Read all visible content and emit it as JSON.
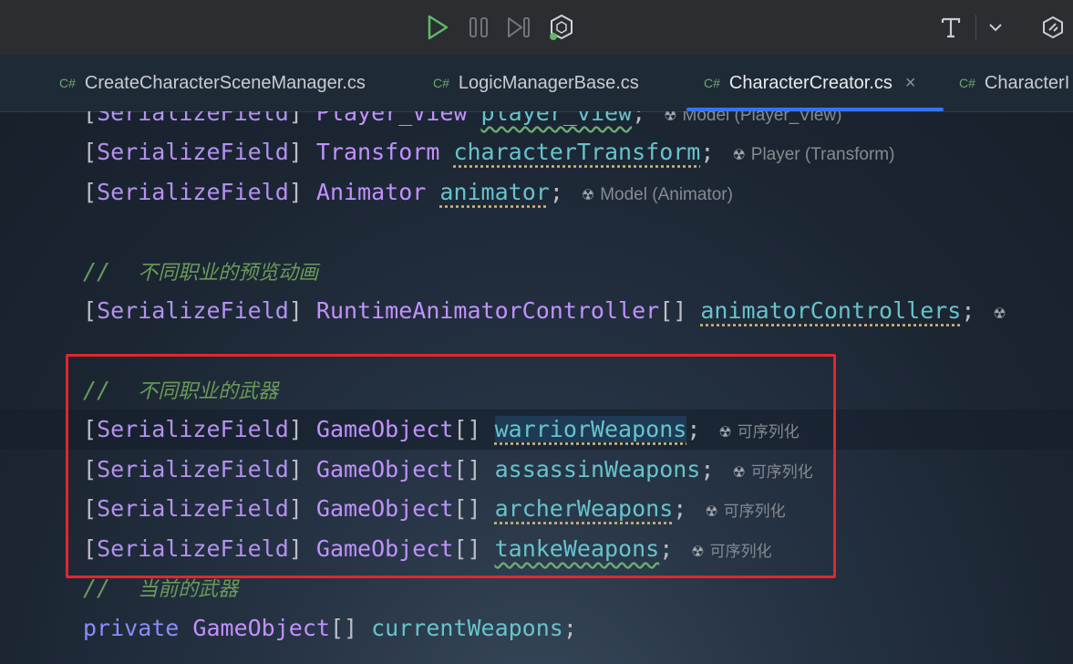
{
  "toolbar": {
    "run_icon": "play-icon",
    "pause_icon": "pause-icon",
    "step_icon": "step-icon",
    "unity_icon": "unity-debug-icon",
    "t_icon": "text-t-icon",
    "dropdown_icon": "chevron-down-icon",
    "settings_icon": "plugin-icon"
  },
  "tabs": [
    {
      "badge": "C#",
      "label": "CreateCharacterSceneManager.cs"
    },
    {
      "badge": "C#",
      "label": "LogicManagerBase.cs"
    },
    {
      "badge": "C#",
      "label": "CharacterCreator.cs",
      "close": "×"
    },
    {
      "badge": "C#",
      "label": "CharacterI"
    }
  ],
  "code": {
    "l0": {
      "open": "[",
      "attr": "SerializeField",
      "close": "]",
      "type": "Player_View",
      "field": "player_view",
      "semi": ";",
      "hint": "Model (Player_View)"
    },
    "l1": {
      "open": "[",
      "attr": "SerializeField",
      "close": "]",
      "type": "Transform",
      "field": "characterTransform",
      "semi": ";",
      "hint": "Player (Transform)"
    },
    "l2": {
      "open": "[",
      "attr": "SerializeField",
      "close": "]",
      "type": "Animator",
      "field": "animator",
      "semi": ";",
      "hint": "Model (Animator)"
    },
    "c1": {
      "slashes": "//",
      "text": "不同职业的预览动画"
    },
    "l3": {
      "open": "[",
      "attr": "SerializeField",
      "close": "]",
      "type": "RuntimeAnimatorController",
      "arr": "[]",
      "field": "animatorControllers",
      "semi": ";"
    },
    "c2": {
      "slashes": "//",
      "text": "不同职业的武器"
    },
    "l4": {
      "open": "[",
      "attr": "SerializeField",
      "close": "]",
      "type": "GameObject",
      "arr": "[]",
      "field": "warriorWeapons",
      "semi": ";",
      "hint": "可序列化"
    },
    "l5": {
      "open": "[",
      "attr": "SerializeField",
      "close": "]",
      "type": "GameObject",
      "arr": "[]",
      "field": "assassinWeapons",
      "semi": ";",
      "hint": "可序列化"
    },
    "l6": {
      "open": "[",
      "attr": "SerializeField",
      "close": "]",
      "type": "GameObject",
      "arr": "[]",
      "field": "archerWeapons",
      "semi": ";",
      "hint": "可序列化"
    },
    "l7": {
      "open": "[",
      "attr": "SerializeField",
      "close": "]",
      "type": "GameObject",
      "arr": "[]",
      "field": "tankeWeapons",
      "semi": ";",
      "hint": "可序列化"
    },
    "c3": {
      "slashes": "//",
      "text": "当前的武器"
    },
    "l8": {
      "kw": "private",
      "type": "GameObject",
      "arr": "[]",
      "field": "currentWeapons",
      "semi": ";"
    }
  },
  "colors": {
    "highlight_box": "#e3262b",
    "active_tab_underline": "#3574f0"
  }
}
